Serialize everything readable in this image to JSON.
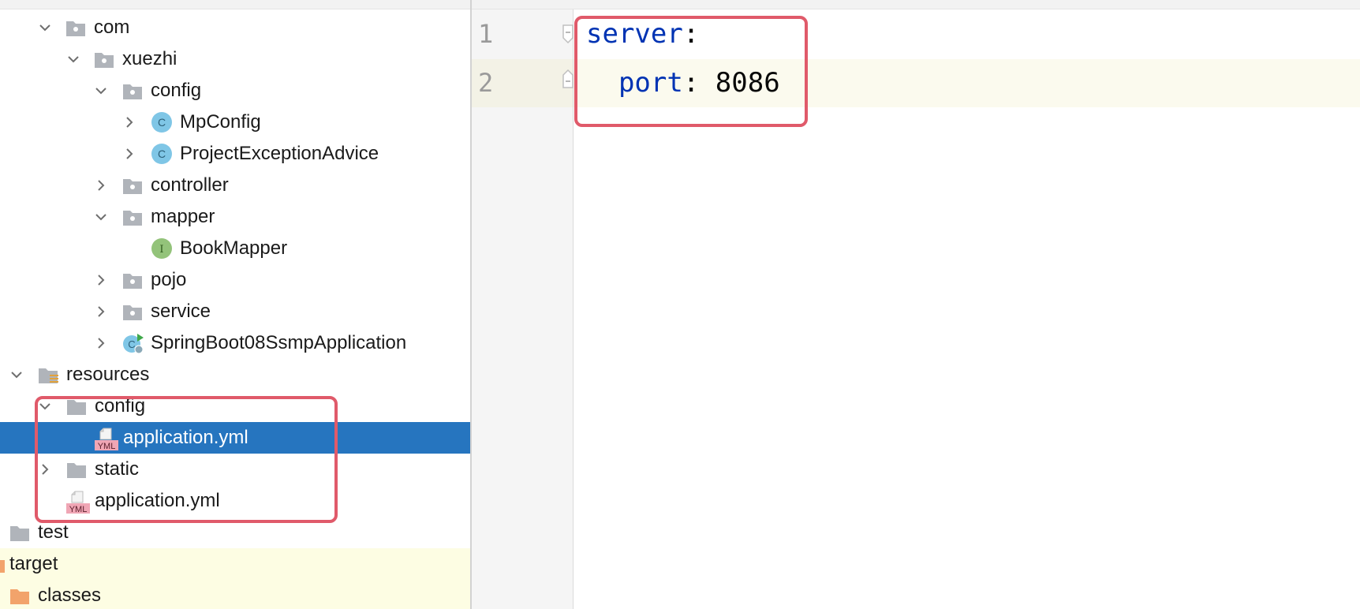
{
  "project_tree": {
    "rows": [
      {
        "label": "com",
        "kind": "package",
        "expanded": true
      },
      {
        "label": "xuezhi",
        "kind": "package",
        "expanded": true
      },
      {
        "label": "config",
        "kind": "package",
        "expanded": true
      },
      {
        "label": "MpConfig",
        "kind": "class",
        "badge": "C"
      },
      {
        "label": "ProjectExceptionAdvice",
        "kind": "class",
        "badge": "C"
      },
      {
        "label": "controller",
        "kind": "package",
        "expanded": false
      },
      {
        "label": "mapper",
        "kind": "package",
        "expanded": true
      },
      {
        "label": "BookMapper",
        "kind": "interface",
        "badge": "I"
      },
      {
        "label": "pojo",
        "kind": "package",
        "expanded": false
      },
      {
        "label": "service",
        "kind": "package",
        "expanded": false
      },
      {
        "label": "SpringBoot08SsmpApplication",
        "kind": "spring-boot-class",
        "badge": "C"
      },
      {
        "label": "resources",
        "kind": "resources-folder",
        "expanded": true
      },
      {
        "label": "config",
        "kind": "folder",
        "expanded": true
      },
      {
        "label": "application.yml",
        "kind": "yaml-file",
        "badge": "YML",
        "selected": true
      },
      {
        "label": "static",
        "kind": "folder",
        "expanded": false
      },
      {
        "label": "application.yml",
        "kind": "yaml-file",
        "badge": "YML"
      },
      {
        "label": "test",
        "kind": "folder"
      },
      {
        "label": "target",
        "kind": "excluded-folder"
      },
      {
        "label": "classes",
        "kind": "excluded-folder"
      }
    ]
  },
  "editor": {
    "line_numbers": [
      "1",
      "2"
    ],
    "lines": [
      {
        "indent": "",
        "key": "server",
        "sep": ":",
        "value": ""
      },
      {
        "indent": "  ",
        "key": "port",
        "sep": ": ",
        "value": "8086"
      }
    ]
  },
  "colors": {
    "selection": "#2675bf",
    "highlight_box": "#e05a6a",
    "yaml_key": "#0033b3",
    "class_badge": "#7fc6e6",
    "interface_badge": "#93c37a",
    "excluded_folder": "#f2a36b"
  }
}
